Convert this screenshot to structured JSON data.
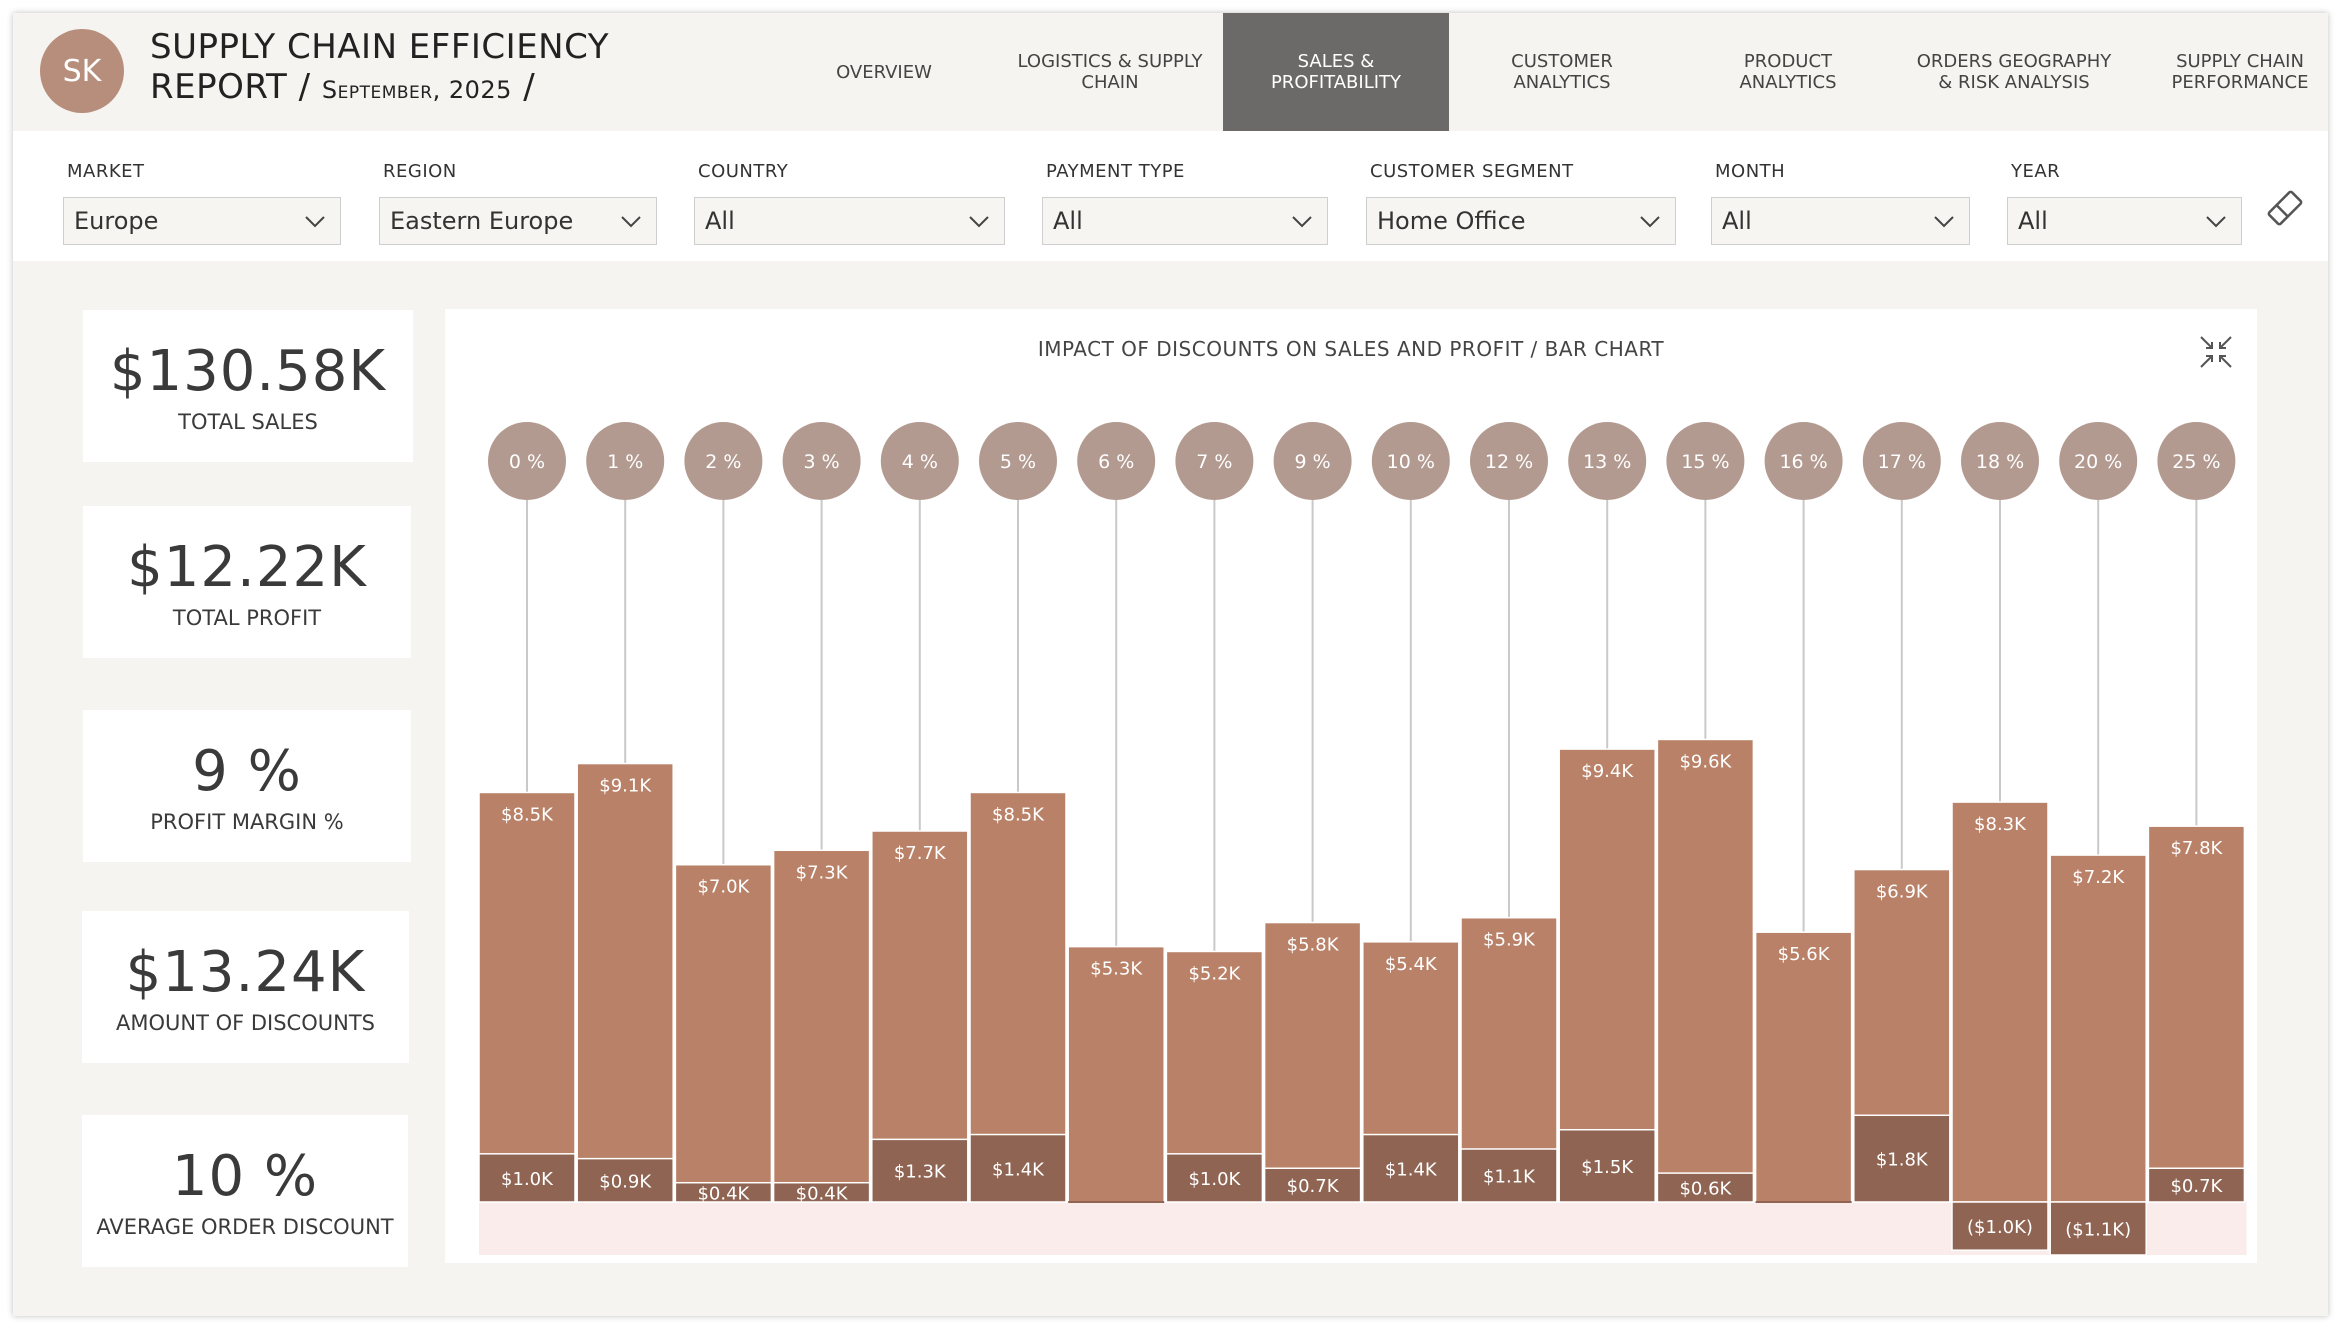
{
  "header": {
    "avatar_initials": "SK",
    "title_line1": "SUPPLY CHAIN EFFICIENCY",
    "title_line2": "REPORT / ",
    "title_date": "September, 2025",
    "title_slash": " /"
  },
  "nav": {
    "tabs": [
      {
        "label": "OVERVIEW",
        "active": false
      },
      {
        "label": "LOGISTICS & SUPPLY\nCHAIN",
        "active": false
      },
      {
        "label": "SALES &\nPROFITABILITY",
        "active": true
      },
      {
        "label": "CUSTOMER\nANALYTICS",
        "active": false
      },
      {
        "label": "PRODUCT\nANALYTICS",
        "active": false
      },
      {
        "label": "ORDERS GEOGRAPHY\n& RISK ANALYSIS",
        "active": false
      },
      {
        "label": "SUPPLY CHAIN\nPERFORMANCE",
        "active": false
      }
    ]
  },
  "filters": [
    {
      "label": "MARKET",
      "value": "Europe"
    },
    {
      "label": "REGION",
      "value": "Eastern Europe"
    },
    {
      "label": "COUNTRY",
      "value": "All"
    },
    {
      "label": "PAYMENT TYPE",
      "value": "All"
    },
    {
      "label": "CUSTOMER SEGMENT",
      "value": "Home Office"
    },
    {
      "label": "MONTH",
      "value": "All"
    },
    {
      "label": "YEAR",
      "value": "All"
    }
  ],
  "kpis": [
    {
      "value": "$130.58K",
      "label": "TOTAL SALES"
    },
    {
      "value": "$12.22K",
      "label": "TOTAL PROFIT"
    },
    {
      "value": "9 %",
      "label": "PROFIT MARGIN %"
    },
    {
      "value": "$13.24K",
      "label": "AMOUNT OF DISCOUNTS"
    },
    {
      "value": "10 %",
      "label": "AVERAGE ORDER DISCOUNT"
    }
  ],
  "colors": {
    "sales_bar": "#b98268",
    "profit_bar": "#8f6452",
    "negative_band": "#fbecec",
    "bubble": "#b39a90",
    "accent": "#b78e7c"
  },
  "icons": {
    "eraser": "eraser-icon",
    "focus": "focus-mode-icon",
    "dropdown": "chevron-down-icon"
  },
  "chart_data": {
    "type": "bar",
    "title": "IMPACT OF DISCOUNTS ON SALES AND PROFIT / BAR CHART",
    "categories": [
      "0 %",
      "1 %",
      "2 %",
      "3 %",
      "4 %",
      "5 %",
      "6 %",
      "7 %",
      "9 %",
      "10 %",
      "12 %",
      "13 %",
      "15 %",
      "16 %",
      "17 %",
      "18 %",
      "20 %",
      "25 %"
    ],
    "series": [
      {
        "name": "",
        "values": [
          8.5,
          9.1,
          7.0,
          7.3,
          7.7,
          8.5,
          5.3,
          5.2,
          5.8,
          5.4,
          5.9,
          9.4,
          9.6,
          5.6,
          6.9,
          8.3,
          7.2,
          7.8
        ],
        "labels": [
          "$8.5K",
          "$9.1K",
          "$7.0K",
          "$7.3K",
          "$7.7K",
          "$8.5K",
          "$5.3K",
          "$5.2K",
          "$5.8K",
          "$5.4K",
          "$5.9K",
          "$9.4K",
          "$9.6K",
          "$5.6K",
          "$6.9K",
          "$8.3K",
          "$7.2K",
          "$7.8K"
        ]
      },
      {
        "name": "",
        "values": [
          1.0,
          0.9,
          0.4,
          0.4,
          1.3,
          1.4,
          null,
          1.0,
          0.7,
          1.4,
          1.1,
          1.5,
          0.6,
          null,
          1.8,
          -1.0,
          -1.1,
          0.7
        ],
        "labels": [
          "$1.0K",
          "$0.9K",
          "$0.4K",
          "$0.4K",
          "$1.3K",
          "$1.4K",
          "",
          "$1.0K",
          "$0.7K",
          "$1.4K",
          "$1.1K",
          "$1.5K",
          "$0.6K",
          "",
          "$1.8K",
          "($1.0K)",
          "($1.1K)",
          "$0.7K"
        ]
      }
    ],
    "unit": "thousands USD",
    "ylim": [
      -1.1,
      11.0
    ],
    "grid": false,
    "legend": "none"
  }
}
